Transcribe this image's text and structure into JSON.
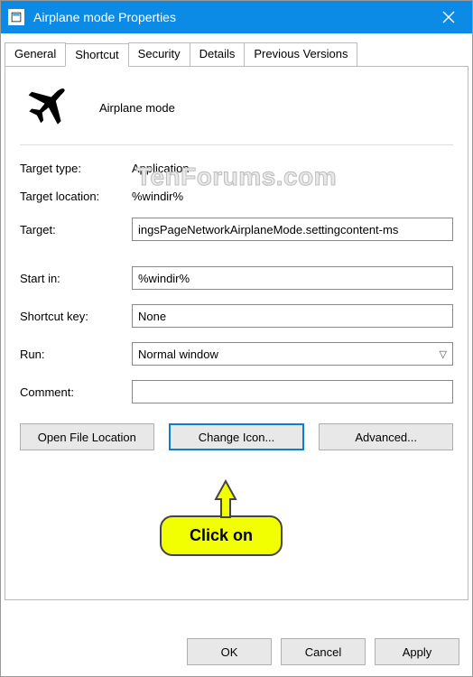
{
  "titlebar": {
    "title": "Airplane mode Properties"
  },
  "tabs": {
    "items": [
      "General",
      "Shortcut",
      "Security",
      "Details",
      "Previous Versions"
    ],
    "active": 1
  },
  "shortcut": {
    "name": "Airplane mode",
    "target_type_label": "Target type:",
    "target_type_value": "Application",
    "target_location_label": "Target location:",
    "target_location_value": "%windir%",
    "target_label": "Target:",
    "target_value": "ingsPageNetworkAirplaneMode.settingcontent-ms",
    "start_in_label": "Start in:",
    "start_in_value": "%windir%",
    "shortcut_key_label": "Shortcut key:",
    "shortcut_key_value": "None",
    "run_label": "Run:",
    "run_value": "Normal window",
    "comment_label": "Comment:",
    "comment_value": ""
  },
  "buttons": {
    "open_file_location": "Open File Location",
    "change_icon": "Change Icon...",
    "advanced": "Advanced..."
  },
  "footer": {
    "ok": "OK",
    "cancel": "Cancel",
    "apply": "Apply"
  },
  "watermark": "TenForums.com",
  "callout": "Click on"
}
